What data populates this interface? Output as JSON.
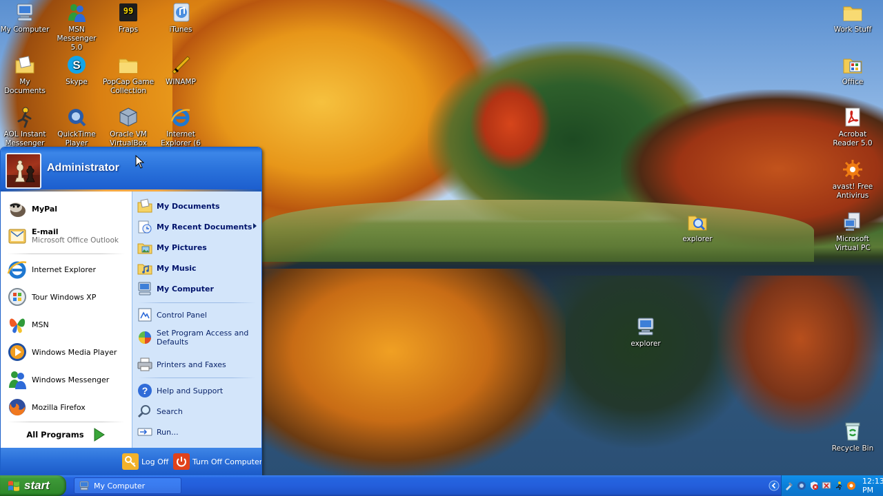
{
  "desktop": {
    "icons_left": [
      {
        "label": "My Computer",
        "icon": "my-computer-icon"
      },
      {
        "label": "MSN Messenger 5.0",
        "icon": "msn-messenger-icon"
      },
      {
        "label": "Fraps",
        "icon": "fraps-icon"
      },
      {
        "label": "iTunes",
        "icon": "itunes-icon"
      },
      {
        "label": "My Documents",
        "icon": "my-documents-icon"
      },
      {
        "label": "Skype",
        "icon": "skype-icon"
      },
      {
        "label": "PopCap Game Collection",
        "icon": "popcap-folder-icon"
      },
      {
        "label": "WINAMP",
        "icon": "winamp-icon"
      },
      {
        "label": "AOL Instant Messenger",
        "icon": "aim-icon"
      },
      {
        "label": "QuickTime Player",
        "icon": "quicktime-icon"
      },
      {
        "label": "Oracle VM VirtualBox",
        "icon": "virtualbox-icon"
      },
      {
        "label": "Internet Explorer (6",
        "icon": "internet-explorer-icon"
      }
    ],
    "icons_right": [
      {
        "label": "Work Stuff",
        "icon": "folder-icon"
      },
      {
        "label": "Office",
        "icon": "office-folder-icon"
      },
      {
        "label": "Acrobat Reader 5.0",
        "icon": "acrobat-icon"
      },
      {
        "label": "avast! Free Antivirus",
        "icon": "avast-icon"
      },
      {
        "label": "Microsoft Virtual PC",
        "icon": "virtual-pc-icon"
      },
      {
        "label": "Recycle Bin",
        "icon": "recycle-bin-icon"
      }
    ],
    "icons_floating": [
      {
        "label": "explorer",
        "icon": "explorer-folder-icon"
      },
      {
        "label": "explorer",
        "icon": "explorer-computer-icon"
      }
    ]
  },
  "start_menu": {
    "user_name": "Administrator",
    "pinned": [
      {
        "label": "MyPal",
        "icon": "mypal-icon"
      },
      {
        "label": "E-mail",
        "sub": "Microsoft Office Outlook",
        "icon": "outlook-icon"
      }
    ],
    "recent": [
      {
        "label": "Internet Explorer",
        "icon": "internet-explorer-icon"
      },
      {
        "label": "Tour Windows XP",
        "icon": "tour-xp-icon"
      },
      {
        "label": "MSN",
        "icon": "msn-butterfly-icon"
      },
      {
        "label": "Windows Media Player",
        "icon": "media-player-icon"
      },
      {
        "label": "Windows Messenger",
        "icon": "windows-messenger-icon"
      },
      {
        "label": "Mozilla Firefox",
        "icon": "firefox-icon"
      }
    ],
    "all_programs": "All Programs",
    "right_places": [
      {
        "label": "My Documents",
        "icon": "my-documents-icon"
      },
      {
        "label": "My Recent Documents",
        "icon": "recent-documents-icon"
      },
      {
        "label": "My Pictures",
        "icon": "my-pictures-icon"
      },
      {
        "label": "My Music",
        "icon": "my-music-icon"
      },
      {
        "label": "My Computer",
        "icon": "my-computer-icon"
      }
    ],
    "right_settings": [
      {
        "label": "Control Panel",
        "icon": "control-panel-icon"
      },
      {
        "label": "Set Program Access and Defaults",
        "icon": "program-defaults-icon"
      },
      {
        "label": "Printers and Faxes",
        "icon": "printer-icon"
      }
    ],
    "right_tools": [
      {
        "label": "Help and Support",
        "icon": "help-icon"
      },
      {
        "label": "Search",
        "icon": "search-icon"
      },
      {
        "label": "Run...",
        "icon": "run-icon"
      }
    ],
    "log_off": "Log Off",
    "turn_off": "Turn Off Computer"
  },
  "taskbar": {
    "start_label": "start",
    "tasks": [
      {
        "label": "My Computer",
        "icon": "my-computer-icon"
      }
    ],
    "clock": "12:13 PM"
  },
  "colors": {
    "xp_blue": "#245edb",
    "start_green": "#379032",
    "tray_blue": "#0f8be6",
    "menu_right_bg": "#d3e5fa"
  }
}
